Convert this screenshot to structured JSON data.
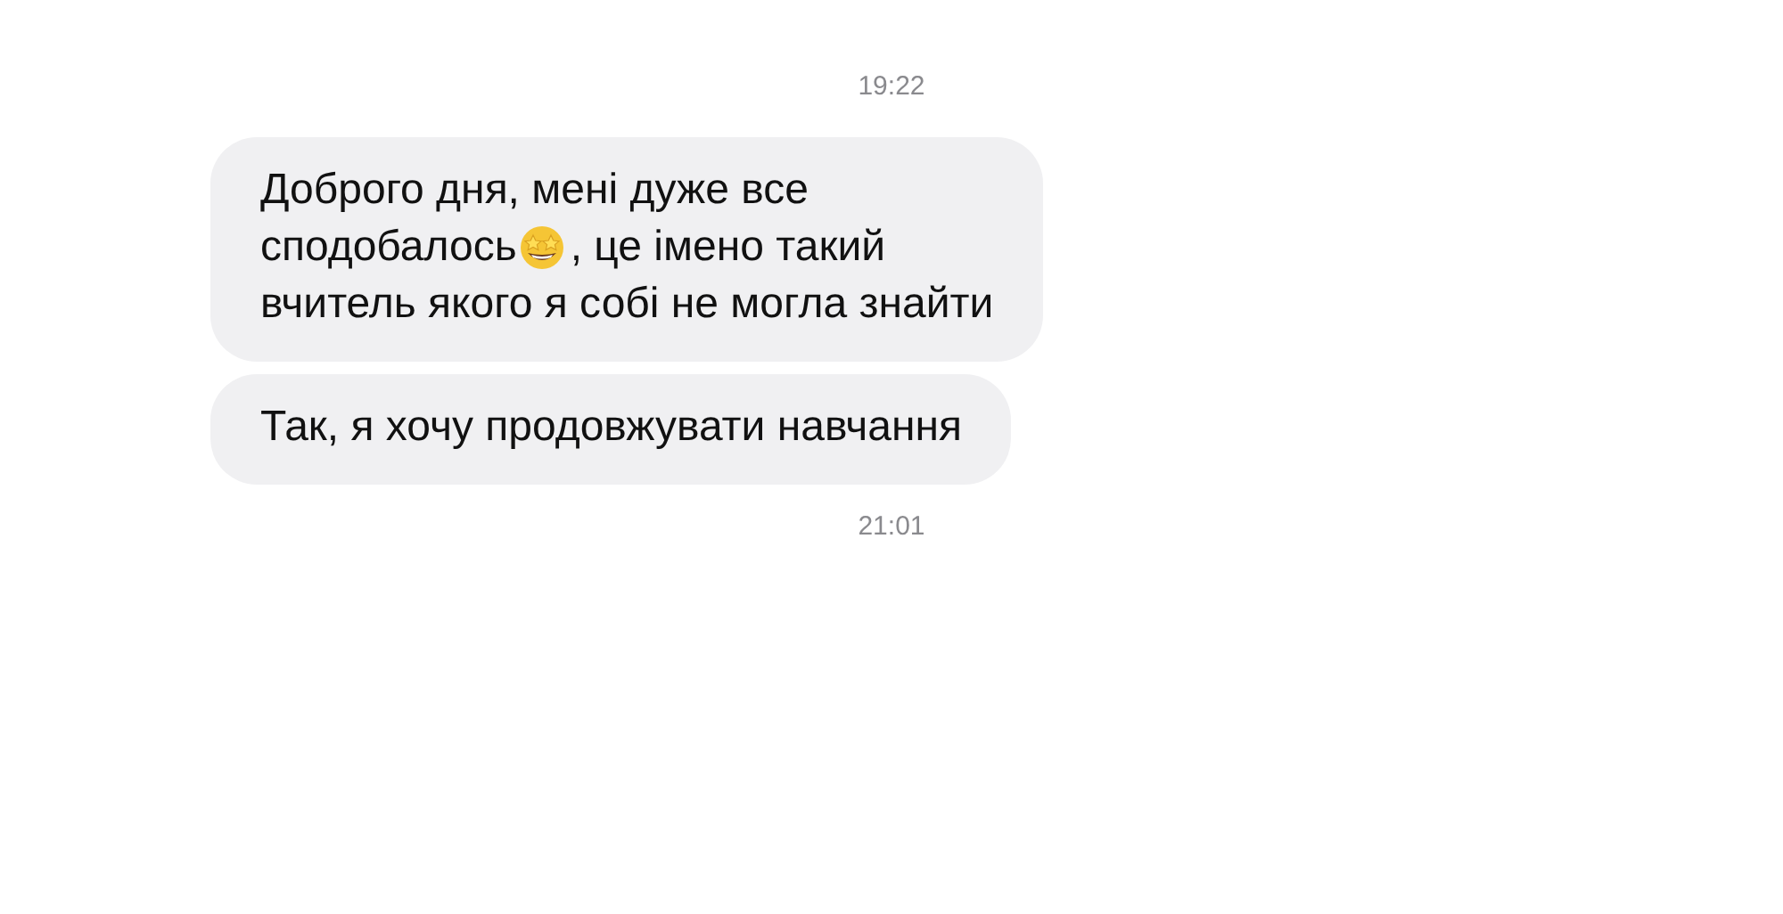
{
  "messages": [
    {
      "kind": "time",
      "text": "19:22"
    },
    {
      "kind": "bubble",
      "lines": [
        [
          {
            "kind": "text",
            "text": "Доброго дня, мені дуже все"
          }
        ],
        [
          {
            "kind": "text",
            "text": "сподобалось"
          },
          {
            "kind": "emoji"
          },
          {
            "kind": "text",
            "text": ", це імено такий"
          }
        ],
        [
          {
            "kind": "text",
            "text": "вчитель якого я собі не могла знайти"
          }
        ]
      ]
    },
    {
      "kind": "bubble",
      "lines": [
        [
          {
            "kind": "text",
            "text": "Так, я хочу продовжувати навчання"
          }
        ]
      ]
    },
    {
      "kind": "time",
      "text": "21:01"
    }
  ]
}
